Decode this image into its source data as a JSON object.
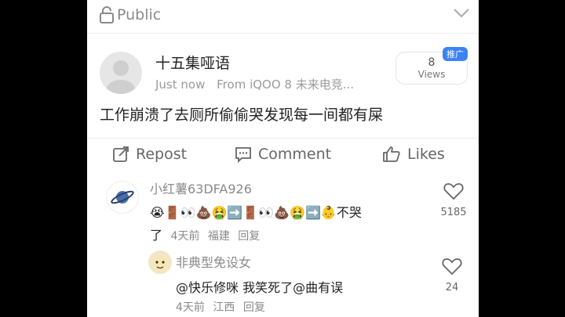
{
  "header": {
    "visibility_label": "Public",
    "lock_icon": "lock-open-icon",
    "chevron_icon": "chevron-down-icon"
  },
  "post": {
    "author_name": "十五集哑语",
    "time": "Just now",
    "source": "From iQOO 8 未来电竞...",
    "views_count": "8",
    "views_label": "Views",
    "promo_badge": "推广",
    "content": "工作崩溃了去厕所偷偷哭发现每一间都有屎"
  },
  "actions": {
    "repost": "Repost",
    "comment": "Comment",
    "likes": "Likes"
  },
  "comments": [
    {
      "username": "小红薯63DFA926",
      "text_line1": "😭🚪👀💩🤮➡️🚪👀💩🤮➡️👶不哭",
      "text_line2": "了",
      "date": "4天前",
      "location": "福建",
      "reply_label": "回复",
      "likes": "5185"
    },
    {
      "username": "非典型免设女",
      "text": "@快乐修咪  我笑死了@曲有误",
      "date": "4天前",
      "location": "江西",
      "reply_label": "回复",
      "likes": "24"
    }
  ]
}
